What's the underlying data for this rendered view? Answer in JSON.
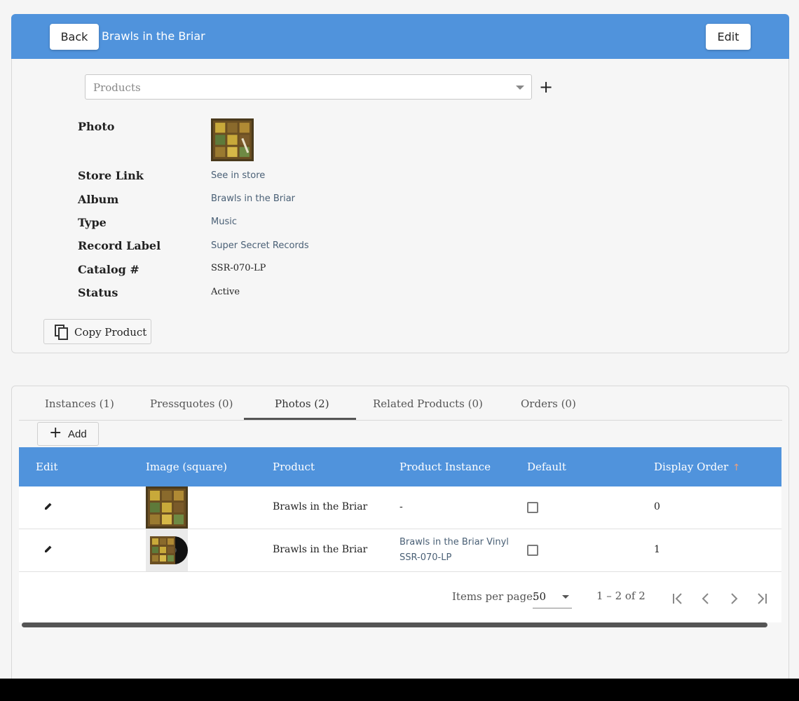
{
  "header": {
    "back_label": "Back",
    "title": "Brawls in the Briar",
    "edit_label": "Edit"
  },
  "product_selector": {
    "placeholder": "Products",
    "add_label": "+"
  },
  "details": {
    "photo_label": "Photo",
    "store_link_label": "Store Link",
    "store_link_value": "See in store",
    "album_label": "Album",
    "album_value": "Brawls in the Briar",
    "type_label": "Type",
    "type_value": "Music",
    "record_label_label": "Record Label",
    "record_label_value": "Super Secret Records",
    "catalog_label": "Catalog #",
    "catalog_value": "SSR-070-LP",
    "status_label": "Status",
    "status_value": "Active"
  },
  "copy_button_label": "Copy Product",
  "tabs": [
    {
      "label": "Instances (1)"
    },
    {
      "label": "Pressquotes (0)"
    },
    {
      "label": "Photos (2)",
      "active": true
    },
    {
      "label": "Related Products (0)"
    },
    {
      "label": "Orders (0)"
    }
  ],
  "add_button_label": "Add",
  "table": {
    "headers": {
      "edit": "Edit",
      "image": "Image (square)",
      "product": "Product",
      "instance": "Product Instance",
      "default": "Default",
      "display_order": "Display Order"
    },
    "sort_arrow": "↑",
    "rows": [
      {
        "product": "Brawls in the Briar",
        "instance": "-",
        "instance_link": false,
        "default": false,
        "display_order": "0"
      },
      {
        "product": "Brawls in the Briar",
        "instance": "Brawls in the Briar Vinyl SSR-070-LP",
        "instance_link": true,
        "default": false,
        "display_order": "1"
      }
    ]
  },
  "paginator": {
    "items_per_page_label": "Items per page:",
    "items_per_page_value": "50",
    "range_label": "1 – 2 of 2"
  },
  "colors": {
    "header_blue": "#5093dc",
    "link_slate": "#4a6076",
    "sort_arrow": "#f0a07a"
  }
}
